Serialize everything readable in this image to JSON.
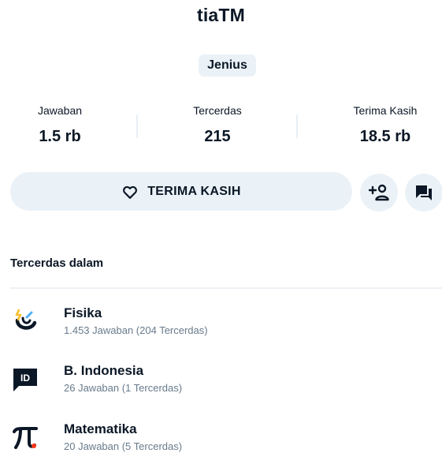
{
  "profile": {
    "username": "tiaTM",
    "rank": "Jenius"
  },
  "stats": [
    {
      "label": "Jawaban",
      "value": "1.5 rb"
    },
    {
      "label": "Tercerdas",
      "value": "215"
    },
    {
      "label": "Terima Kasih",
      "value": "18.5 rb"
    }
  ],
  "actions": {
    "thanks_label": "TERIMA KASIH"
  },
  "best_in": {
    "title": "Tercerdas dalam",
    "subjects": [
      {
        "name": "Fisika",
        "count": "1.453 Jawaban (204 Tercerdas)",
        "icon": "physics-magnet-icon"
      },
      {
        "name": "B. Indonesia",
        "count": "26 Jawaban (1 Tercerdas)",
        "icon": "indonesian-id-icon",
        "icon_text": "ID"
      },
      {
        "name": "Matematika",
        "count": "20 Jawaban (5 Tercerdas)",
        "icon": "math-pi-icon"
      }
    ]
  },
  "colors": {
    "text": "#0b1726",
    "muted": "#687b8c",
    "chip_bg": "#ebf2f7",
    "accent_yellow": "#fbbe2e",
    "accent_blue": "#4fb3f6",
    "accent_red": "#ff341a"
  }
}
